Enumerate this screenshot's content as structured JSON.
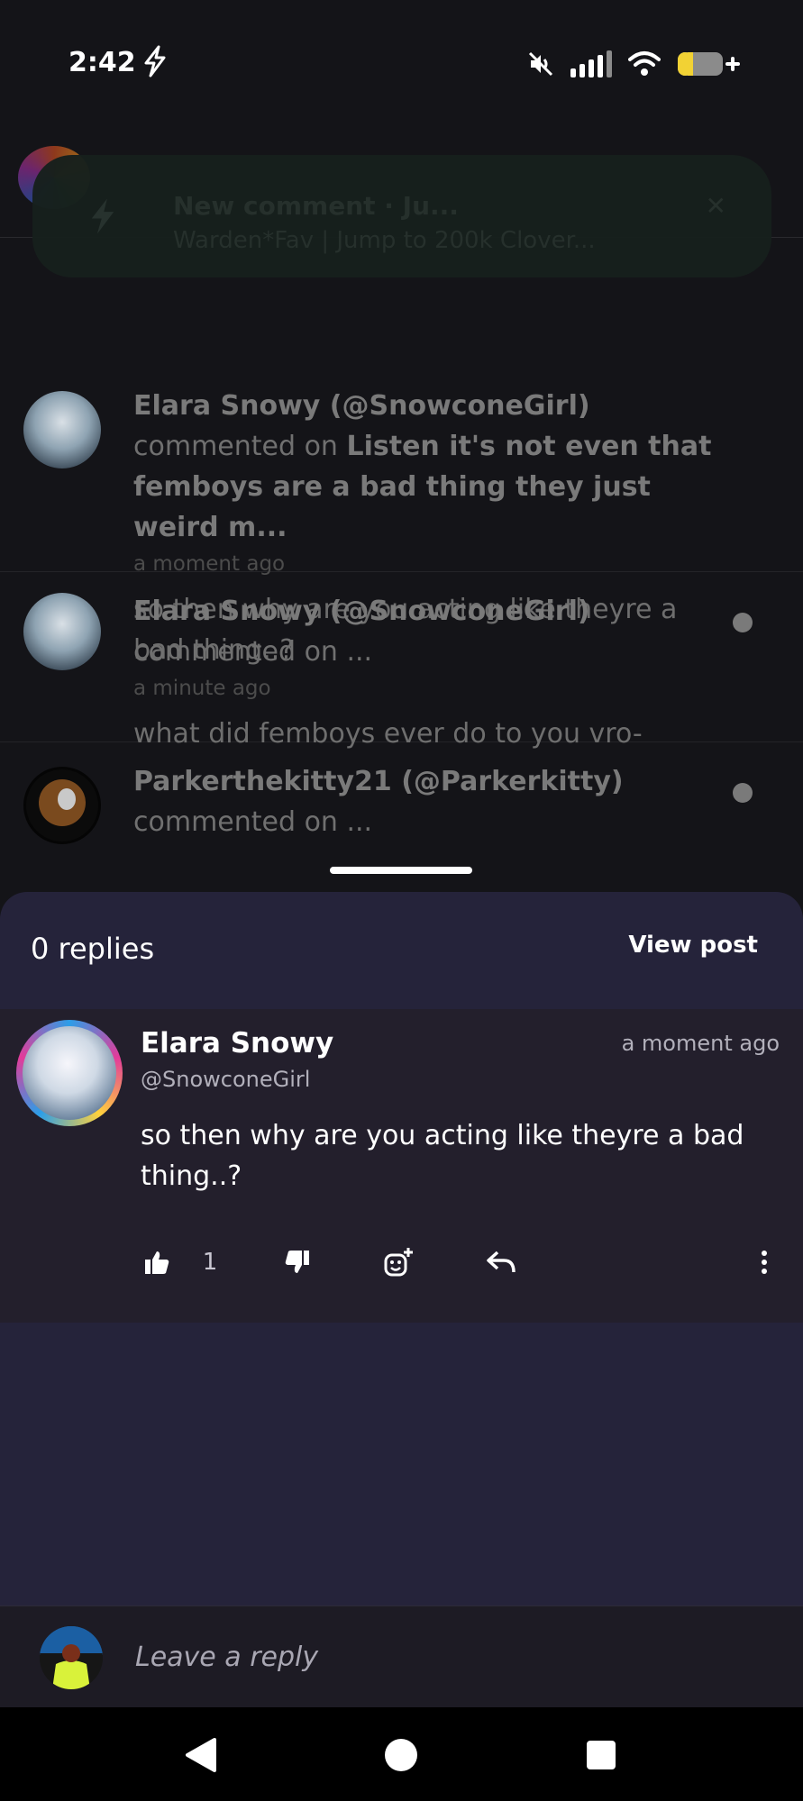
{
  "status_bar": {
    "time": "2:42",
    "icons": [
      "flash-icon",
      "mute-icon",
      "signal-icon",
      "wifi-icon",
      "battery-charging-icon"
    ]
  },
  "toast": {
    "title": "New comment · Ju...",
    "subtitle": "Warden*Fav | Jump to 200k Clover..."
  },
  "background_notifications": [
    {
      "author": "Elara Snowy (@SnowconeGirl)",
      "action": "commented on",
      "target": "Listen it's not even that femboys are a bad thing they just weird m...",
      "time": "a moment ago",
      "text": "so then why are you acting like theyre a bad thing..?"
    },
    {
      "author": "Elara Snowy (@SnowconeGirl)",
      "action": "commented on ...",
      "time": "a minute ago",
      "text": "what did femboys ever do to you vro-"
    },
    {
      "author": "Parkerthekitty21 (@Parkerkitty)",
      "action": "commented on ..."
    }
  ],
  "sheet": {
    "replies_label": "0 replies",
    "view_post_label": "View post",
    "comment": {
      "name": "Elara Snowy",
      "handle": "@SnowconeGirl",
      "time": "a moment ago",
      "text": "so then why are you acting like theyre a bad thing..?",
      "like_count": "1"
    }
  },
  "reply": {
    "placeholder": "Leave a reply"
  },
  "colors": {
    "sheet_bg": "#25233a",
    "card_bg": "#231f2c",
    "battery": "#f2d234"
  }
}
